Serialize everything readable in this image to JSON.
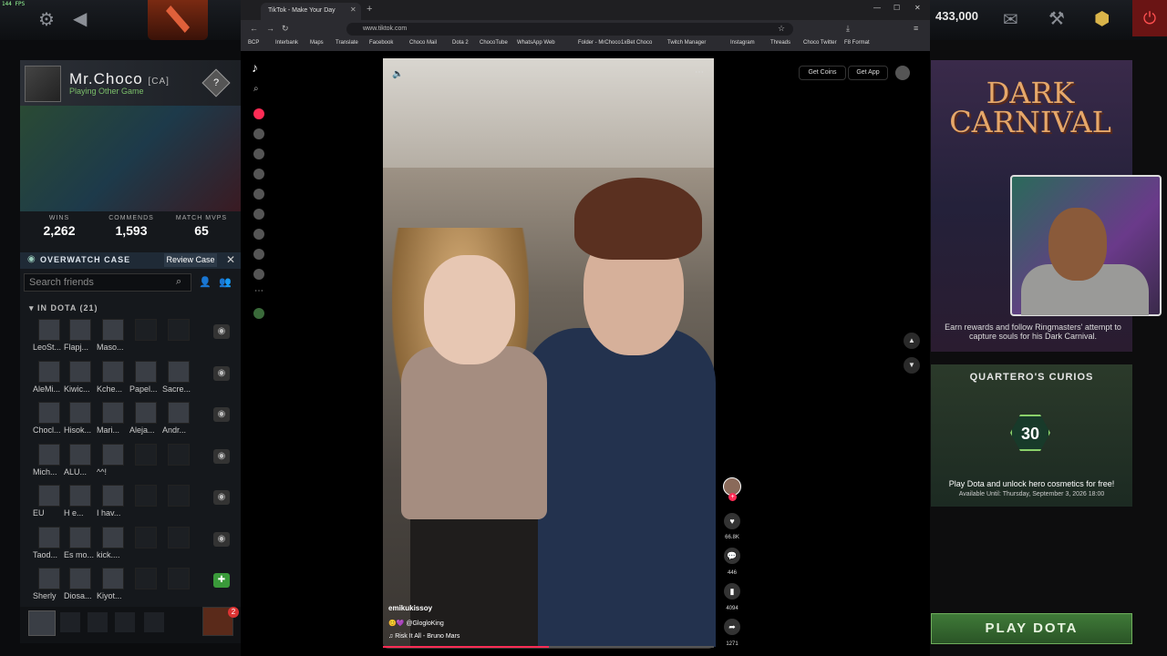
{
  "fps": "144 FPS",
  "dota_top": {
    "shards": "433,000"
  },
  "profile": {
    "name": "Mr.Choco",
    "tag": "[CA]",
    "status": "Playing Other Game",
    "rank_glyph": "?"
  },
  "stats": [
    {
      "label": "WINS",
      "value": "2,262"
    },
    {
      "label": "COMMENDS",
      "value": "1,593"
    },
    {
      "label": "MATCH MVPS",
      "value": "65"
    }
  ],
  "overwatch": {
    "label": "OVERWATCH CASE",
    "button": "Review Case"
  },
  "friends": {
    "search_placeholder": "Search friends",
    "group": "IN DOTA (21)",
    "rows": [
      [
        "LeoSt...",
        "Flapj...",
        "Maso..."
      ],
      [
        "AleMi...",
        "Kiwic...",
        "Kche...",
        "Papel...",
        "Sacre..."
      ],
      [
        "Chocl...",
        "Hisok...",
        "Mari...",
        "Aleja...",
        "Andr..."
      ],
      [
        "Mich...",
        "ALU...",
        "^^!"
      ],
      [
        "EU",
        "H e...",
        "I hav..."
      ],
      [
        "Taod...",
        "Es mo...",
        "kick...."
      ],
      [
        "Sherly",
        "Diosa...",
        "Kiyot..."
      ]
    ]
  },
  "party": {
    "badge": "2"
  },
  "browser": {
    "tab_title": "TikTok - Make Your Day",
    "url": "www.tiktok.com",
    "bookmarks": [
      "BCP",
      "Interbank",
      "Maps",
      "Translate",
      "Facebook",
      "Choco Mail",
      "Dota 2",
      "ChocoTube",
      "WhatsApp Web",
      "Folder - MrChoco",
      "1xBet Choco",
      "Twitch Manager",
      "Instagram",
      "Threads",
      "Choco Twitter",
      "F8 Format"
    ]
  },
  "tiktok": {
    "get_coins": "Get Coins",
    "get_app": "Get App",
    "author": "emikukissoy",
    "desc": "😊💜 @GlogloKing",
    "music": "♫  Risk It All - Bruno Mars",
    "likes": "66.8K",
    "comments": "446",
    "saves": "4094",
    "shares": "1271",
    "progress": 0.5
  },
  "right": {
    "carnival_title": "DARK CARNIVAL",
    "carnival_text": "Earn rewards and follow Ringmasters' attempt to capture souls for his Dark Carnival.",
    "curios_title": "QUARTERO'S CURIOS",
    "curios_badge": "30",
    "curios_text": "Play Dota and unlock hero cosmetics for free!",
    "curios_avail": "Available Until:  Thursday, September 3, 2026 18:00",
    "play": "PLAY DOTA"
  }
}
